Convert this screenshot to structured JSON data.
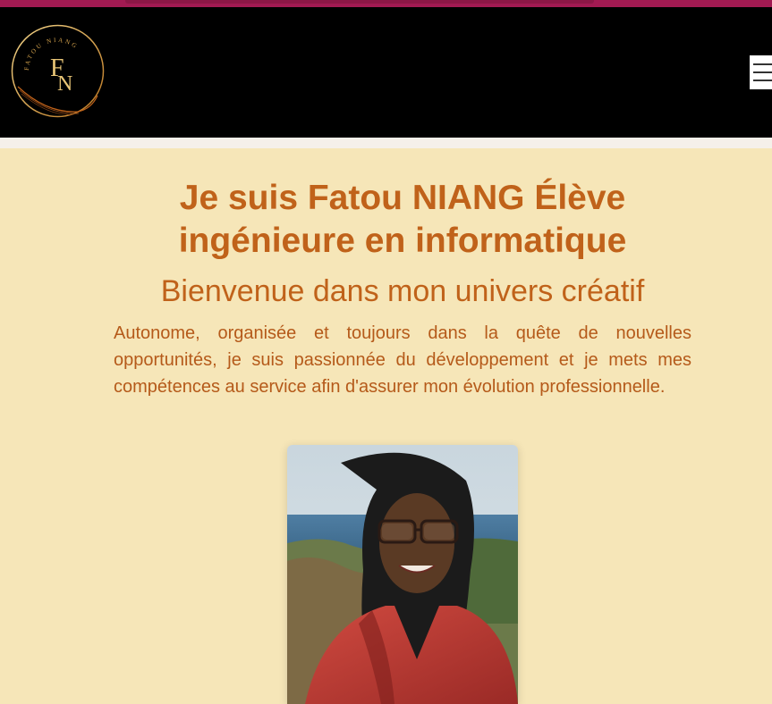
{
  "colors": {
    "top_accent": "#a21a52",
    "header_bg": "#000000",
    "hero_bg": "#f6e6b8",
    "accent_text": "#c0621a",
    "logo_gold": "#d4a24c"
  },
  "header": {
    "logo": {
      "ring_text": "FATOU NIANG",
      "initials_f": "F",
      "initials_n": "N"
    },
    "menu_icon": "hamburger-menu-icon"
  },
  "hero": {
    "title": "Je suis Fatou NIANG Élève ingénieure en informatique",
    "subtitle": "Bienvenue dans mon univers créatif",
    "intro": "Autonome, organisée et toujours dans la quête de nouvelles opportunités, je suis passionnée du développement et je mets mes compétences au service afin d'assurer mon évolution professionnelle."
  }
}
